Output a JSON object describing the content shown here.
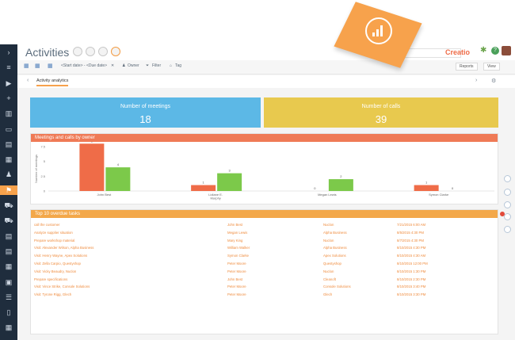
{
  "sidebar": {
    "icons": [
      "chevron-right-icon",
      "menu-icon",
      "play-icon",
      "plus-icon",
      "chart-icon",
      "chat-icon",
      "bank-icon",
      "building-icon",
      "contact-icon",
      "flag-icon",
      "cart-icon",
      "cart-alt-icon",
      "document-icon",
      "document-alt-icon",
      "document-box-icon",
      "folder-icon",
      "list-icon",
      "book-icon",
      "stats-icon"
    ],
    "active_index": 9
  },
  "header": {
    "title": "Activities",
    "brand": "Creatio"
  },
  "filters": {
    "start_date": "<Start date> - <Due date>",
    "owner": "Owner",
    "filter": "Filter",
    "tag": "Tag",
    "reports": "Reports",
    "view": "View"
  },
  "tabs": {
    "active": "Activity analytics"
  },
  "cards": {
    "meetings_label": "Number of meetings",
    "meetings_value": "18",
    "calls_label": "Number of calls",
    "calls_value": "39"
  },
  "chart_panel": {
    "title": "Meetings and calls by owner"
  },
  "chart_data": {
    "type": "bar",
    "categories": [
      "John Best",
      "Lidiane E.\nMurphy",
      "Megan Lewis",
      "Symon Clarke"
    ],
    "series": [
      {
        "name": "Meetings",
        "values": [
          8,
          1,
          0,
          1
        ],
        "color": "#ef6c48"
      },
      {
        "name": "Calls",
        "values": [
          4,
          3,
          2,
          0
        ],
        "color": "#7cc94a"
      }
    ],
    "ylabel": "Number of meetings",
    "ylim": [
      0,
      7.5
    ],
    "yticks": [
      "7.5",
      "5",
      "2.5",
      "0"
    ]
  },
  "tasks_panel": {
    "title": "Top 10 overdue tasks",
    "rows": [
      [
        "call the customer",
        "John Best",
        "Nuclon",
        "7/21/2015 6:00 AM"
      ],
      [
        "Analyze supplier situation",
        "Megan Lewis",
        "Alpha Business",
        "8/5/2015 4:30 PM"
      ],
      [
        "Prepare workshop material",
        "Mary King",
        "Nuclon",
        "8/7/2015 4:30 PM"
      ],
      [
        "Visit: Alexander Wilson, Alpha Business",
        "William Walker",
        "Alpha Business",
        "8/10/2015 4:30 PM"
      ],
      [
        "Visit: Henry Wayne, Apex Solutions",
        "Symon Clarke",
        "Apex Solutions",
        "8/10/2015 4:30 AM"
      ],
      [
        "Visit: Zella Carpio, Questyshop",
        "Peter Moore",
        "Questyshop",
        "8/10/2015 12:00 PM"
      ],
      [
        "Visit: Vicky Beaudry, Nuclon",
        "Peter Moore",
        "Nuclon",
        "8/10/2015 1:30 PM"
      ],
      [
        "Prepare specifications",
        "John Best",
        "Cleanoft",
        "8/10/2015 2:30 PM"
      ],
      [
        "Visit: Vince Strike, Console Solutions",
        "Peter Moore",
        "Console Solutions",
        "8/10/2015 3:40 PM"
      ],
      [
        "Visit: Tyrone Rigg, Glech",
        "Peter Moore",
        "Glech",
        "8/10/2015 3:30 PM"
      ]
    ]
  },
  "colors": {
    "meetings_card": "#5cb8e6",
    "calls_card": "#e8c94e",
    "chart_header": "#ef7a56",
    "tasks_header": "#f3a84a",
    "accent": "#f7a24c"
  }
}
